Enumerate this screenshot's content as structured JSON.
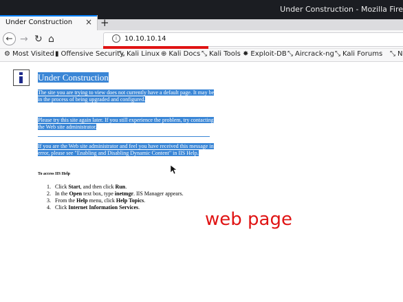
{
  "window": {
    "title": "Under Construction - Mozilla Fire"
  },
  "tab": {
    "label": "Under Construction",
    "close_glyph": "×",
    "new_tab_glyph": "+"
  },
  "nav": {
    "back_glyph": "←",
    "forward_glyph": "→",
    "reload_glyph": "↻",
    "home_glyph": "⌂",
    "url": "10.10.10.14",
    "url_icon": "info-icon"
  },
  "bookmarks": [
    {
      "label": "Most Visited",
      "icon": "gear-icon",
      "glyph": "⚙"
    },
    {
      "label": "Offensive Security",
      "icon": "offsec-icon",
      "glyph": "▮"
    },
    {
      "label": "Kali Linux",
      "icon": "kali-icon",
      "glyph": "⤡"
    },
    {
      "label": "Kali Docs",
      "icon": "globe-icon",
      "glyph": "⊕"
    },
    {
      "label": "Kali Tools",
      "icon": "kali-icon",
      "glyph": "⤡"
    },
    {
      "label": "Exploit-DB",
      "icon": "exploitdb-icon",
      "glyph": "✸"
    },
    {
      "label": "Aircrack-ng",
      "icon": "aircrack-icon",
      "glyph": "⤡"
    },
    {
      "label": "Kali Forums",
      "icon": "kali-icon",
      "glyph": "⤡"
    },
    {
      "label": "Neth",
      "icon": "kali-icon",
      "glyph": "⤡"
    }
  ],
  "page": {
    "heading": "Under Construction",
    "para1": "The site you are trying to view does not currently have a default page. It may be in the process of being upgraded and configured.",
    "para2": "Please try this site again later. If you still experience the problem, try contacting the Web site administrator.",
    "para3": "If you are the Web site administrator and feel you have received this message in error, please see \"Enabling and Disabling Dynamic Content\" in IIS Help.",
    "subheading": "To access IIS Help",
    "steps": [
      {
        "num": "1.",
        "parts": [
          "Click ",
          "Start",
          ", and then click ",
          "Run",
          "."
        ]
      },
      {
        "num": "2.",
        "parts": [
          "In the ",
          "Open",
          " text box, type ",
          "inetmgr",
          ". IIS Manager appears."
        ]
      },
      {
        "num": "3.",
        "parts": [
          "From the ",
          "Help",
          " menu, click ",
          "Help Topics",
          "."
        ]
      },
      {
        "num": "4.",
        "parts": [
          "Click ",
          "Internet Information Services",
          "."
        ]
      }
    ]
  },
  "annotation": {
    "text": "web page",
    "color": "#e01414"
  },
  "colors": {
    "selection": "#3a86d6",
    "title_bar": "#1b1d22",
    "tab_accent": "#0a84ff"
  }
}
